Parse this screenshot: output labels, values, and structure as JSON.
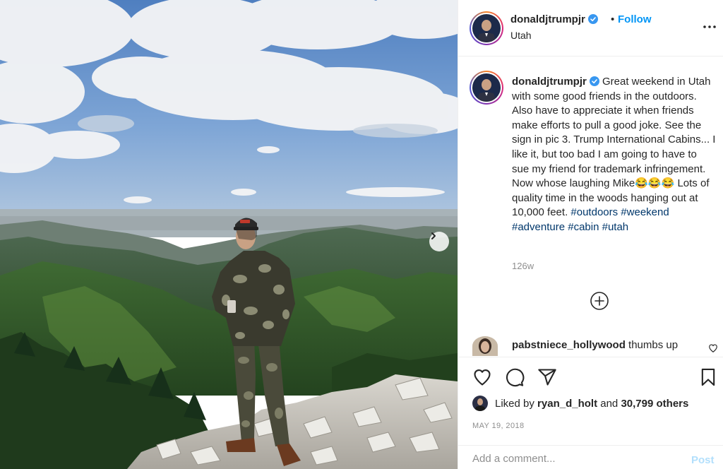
{
  "post": {
    "photo_alt": "Man in camouflage standing on a rocky mountain summit",
    "carousel_next_icon": "chevron-right-icon"
  },
  "header": {
    "username": "donaldjtrumpjr",
    "verified": true,
    "separator": "•",
    "follow_label": "Follow",
    "location": "Utah",
    "more_icon": "more-horizontal-icon"
  },
  "caption": {
    "username": "donaldjtrumpjr",
    "text": "Great weekend in Utah with some good friends in the outdoors. Also have to appreciate it when friends make efforts to pull a good joke. See the sign in pic 3. Trump International Cabins... I like it, but too bad I am going to have to sue my friend for trademark infringement. Now whose laughing Mike😂😂😂 Lots of quality time in the woods hanging out at 10,000 feet.",
    "hashtags": [
      "#outdoors",
      "#weekend",
      "#adventure",
      "#cabin",
      "#utah"
    ],
    "age": "126w"
  },
  "comments": [
    {
      "username": "pabstniece_hollywood",
      "text": "thumbs up"
    }
  ],
  "actions": {
    "like_icon": "heart-icon",
    "comment_icon": "comment-icon",
    "share_icon": "paper-plane-icon",
    "save_icon": "bookmark-icon",
    "load_more_icon": "plus-circle-icon"
  },
  "likes": {
    "prefix": "Liked by",
    "user": "ryan_d_holt",
    "connector": "and",
    "others": "30,799 others"
  },
  "date": "MAY 19, 2018",
  "add_comment": {
    "placeholder": "Add a comment...",
    "post_label": "Post"
  },
  "colors": {
    "accent": "#0095f6",
    "hashtag": "#00376b",
    "muted": "#8e8e8e",
    "post_disabled": "#b2dffc",
    "verified": "#3897f0"
  }
}
